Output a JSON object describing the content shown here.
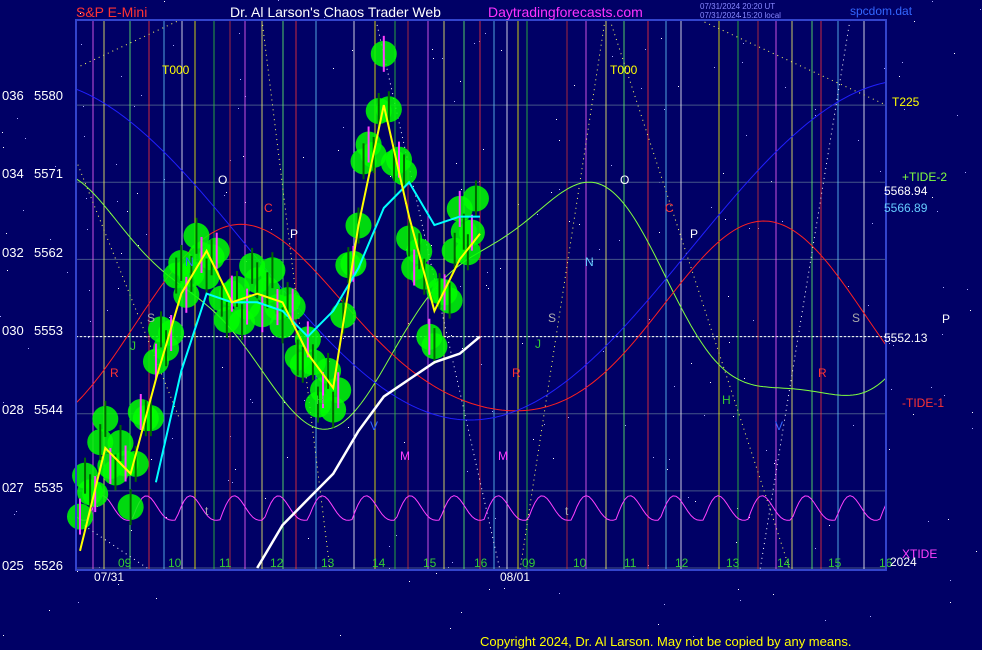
{
  "header": {
    "symbol": "S&P E-Mini",
    "title": "Dr. Al Larson's Chaos Trader Web",
    "site": "Daytradingforecasts.com",
    "stamp_ut": "07/31/2024 20:20 UT",
    "stamp_local": "07/31/2024 15:20 local",
    "software": "spcdom.dat"
  },
  "copyright": "Copyright 2024, Dr. Al Larson. May not be copied by any means.",
  "colors": {
    "background": "#000066",
    "price_bars": "#00ff00",
    "fast_avg": "#ffff00",
    "slow_avg": "#00ffff",
    "white_avg": "#ffffff",
    "tide_plus2": "#80ff40",
    "tide_minus1": "#ff2020",
    "xtide": "#ff40ff",
    "blue_tide": "#2020ff",
    "grid": "#445588"
  },
  "chart_data": {
    "type": "line",
    "title": "",
    "y_ticks": [
      {
        "code": "025",
        "price": 5526
      },
      {
        "code": "027",
        "price": 5535
      },
      {
        "code": "028",
        "price": 5544
      },
      {
        "code": "030",
        "price": 5553
      },
      {
        "code": "032",
        "price": 5562
      },
      {
        "code": "034",
        "price": 5571
      },
      {
        "code": "036",
        "price": 5580
      }
    ],
    "ylim": [
      5526,
      5589
    ],
    "x_hour_ticks": [
      "09",
      "10",
      "11",
      "12",
      "13",
      "14",
      "15",
      "16",
      "09",
      "10",
      "11",
      "12",
      "13",
      "14",
      "15",
      "16"
    ],
    "dates": [
      "07/31",
      "08/01"
    ],
    "year_label": "2024",
    "right_values": {
      "tide_plus2": "5568.94",
      "slow_avg": "5566.89",
      "pivot": "5552.13"
    },
    "right_labels": {
      "tide_plus2": "+TIDE-2",
      "tide_minus1": "-TIDE-1",
      "xtide": "XTIDE",
      "t225": "T225",
      "p": "P"
    },
    "top_markers": [
      "T000",
      "T000"
    ],
    "letter_markers": [
      "O",
      "C",
      "P",
      "N",
      "S",
      "J",
      "R",
      "H",
      "M",
      "V",
      "t",
      "O",
      "C",
      "P",
      "N",
      "S",
      "J",
      "R",
      "H",
      "M",
      "V",
      "t",
      "S",
      "R"
    ],
    "series": [
      {
        "name": "price_close",
        "x": [
          0,
          5,
          10,
          15,
          20,
          25,
          30,
          35,
          40,
          45,
          50,
          55,
          60,
          65,
          70,
          75,
          79
        ],
        "values": [
          5532,
          5541,
          5536,
          5549,
          5560,
          5563,
          5556,
          5559,
          5557,
          5550,
          5545,
          5568,
          5583,
          5566,
          5553,
          5565,
          5567
        ]
      },
      {
        "name": "fast_avg",
        "x": [
          0,
          5,
          10,
          15,
          20,
          25,
          30,
          35,
          40,
          45,
          50,
          55,
          60,
          65,
          70,
          75,
          79
        ],
        "values": [
          5528,
          5540,
          5537,
          5548,
          5558,
          5563,
          5557,
          5558,
          5557,
          5551,
          5547,
          5566,
          5580,
          5567,
          5556,
          5562,
          5565
        ]
      },
      {
        "name": "slow_avg",
        "x": [
          15,
          20,
          25,
          30,
          35,
          40,
          45,
          50,
          55,
          60,
          65,
          70,
          75,
          79
        ],
        "values": [
          5536,
          5549,
          5558,
          5557,
          5557,
          5556,
          5553,
          5556,
          5561,
          5568,
          5571,
          5566,
          5567,
          5567
        ]
      },
      {
        "name": "white_avg",
        "x": [
          35,
          40,
          45,
          50,
          55,
          60,
          65,
          70,
          75,
          79
        ],
        "values": [
          5526,
          5531,
          5534,
          5537,
          5542,
          5546,
          5548,
          5550,
          5551,
          5553
        ]
      }
    ]
  }
}
